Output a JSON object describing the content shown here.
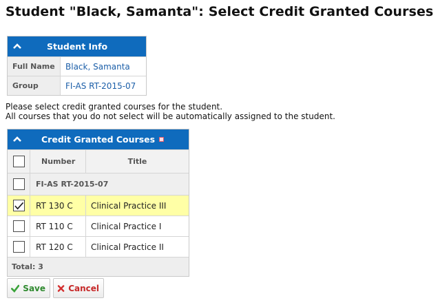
{
  "page": {
    "title": "Student \"Black, Samanta\": Select Credit Granted Courses"
  },
  "student_info": {
    "header": "Student Info",
    "rows": [
      {
        "label": "Full Name",
        "value": "Black, Samanta"
      },
      {
        "label": "Group",
        "value": "FI-AS RT-2015-07"
      }
    ]
  },
  "instructions": {
    "line1": "Please select credit granted courses for the student.",
    "line2": "All courses that you do not select will be automatically assigned to the student."
  },
  "courses": {
    "header": "Credit Granted Courses",
    "columns": {
      "number": "Number",
      "title": "Title"
    },
    "group_label": "FI-AS RT-2015-07",
    "rows": [
      {
        "number": "RT 130 C",
        "title": "Clinical Practice III",
        "checked": true
      },
      {
        "number": "RT 110 C",
        "title": "Clinical Practice I",
        "checked": false
      },
      {
        "number": "RT 120 C",
        "title": "Clinical Practice II",
        "checked": false
      }
    ],
    "total": "Total: 3"
  },
  "buttons": {
    "save": "Save",
    "cancel": "Cancel"
  },
  "colors": {
    "header_blue": "#0f6bbd",
    "selected_row": "#ffffa6",
    "link_blue": "#1b5ea8"
  }
}
